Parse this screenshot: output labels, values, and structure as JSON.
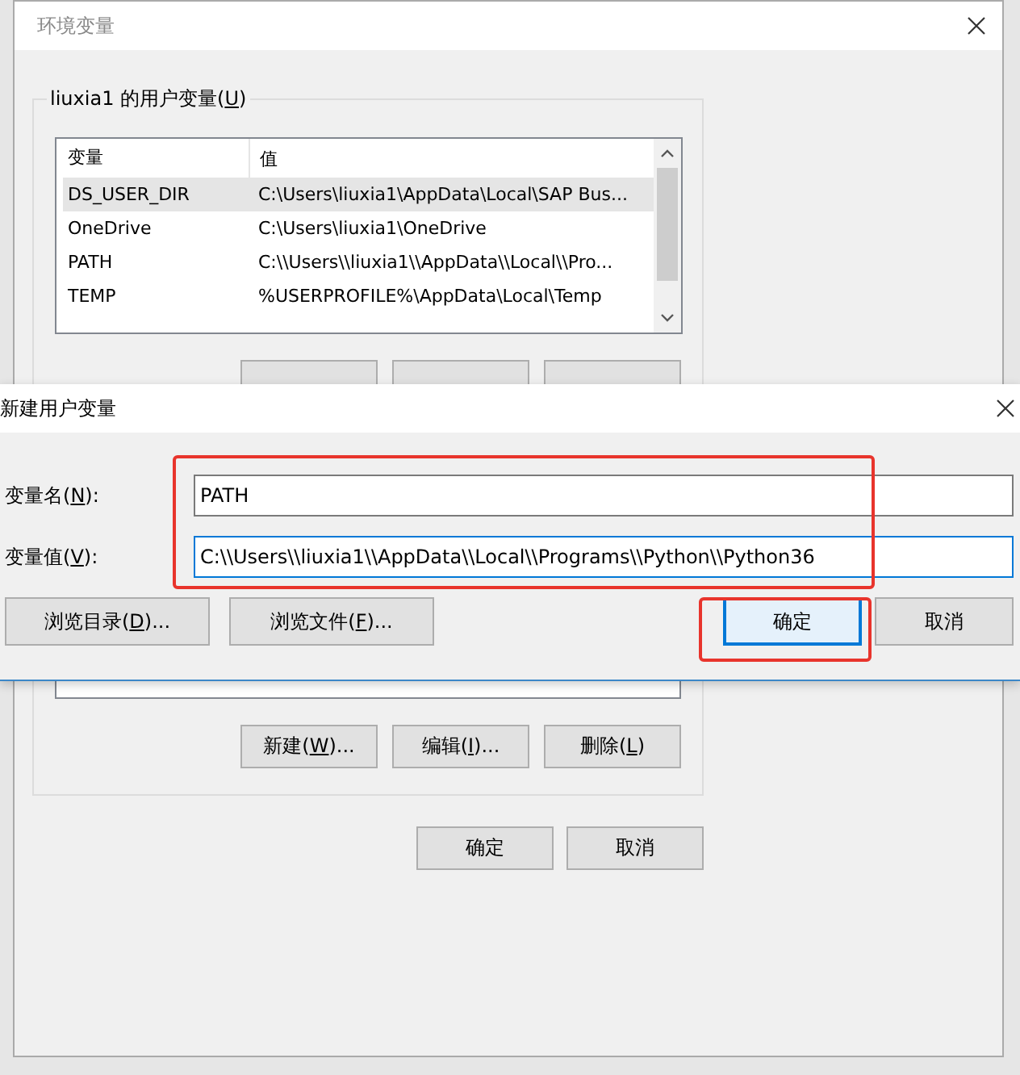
{
  "background_window": {
    "title": "环境变量",
    "user_variables": {
      "legend": {
        "before": "liuxia1 的用户变量(",
        "key": "U",
        "after": ")"
      },
      "columns": [
        "变量",
        "值"
      ],
      "rows": [
        {
          "name": "DS_USER_DIR",
          "value": "C:\\Users\\liuxia1\\AppData\\Local\\SAP Bus...",
          "selected": true
        },
        {
          "name": "OneDrive",
          "value": "C:\\Users\\liuxia1\\OneDrive",
          "selected": false
        },
        {
          "name": "PATH",
          "value": "C:\\\\Users\\\\liuxia1\\\\AppData\\\\Local\\\\Pro...",
          "selected": false
        },
        {
          "name": "TEMP",
          "value": "%USERPROFILE%\\AppData\\Local\\Temp",
          "selected": false
        }
      ]
    },
    "system_buttons": [
      {
        "before": "新建(",
        "key": "W",
        "after": ")..."
      },
      {
        "before": "编辑(",
        "key": "I",
        "after": ")..."
      },
      {
        "before": "删除(",
        "key": "L",
        "after": ")"
      }
    ],
    "buttons": [
      "确定",
      "取消"
    ]
  },
  "dialog": {
    "title": "新建用户变量",
    "fields": [
      {
        "label": {
          "before": "变量名(",
          "key": "N",
          "after": "):"
        },
        "value": "PATH",
        "focused": false
      },
      {
        "label": {
          "before": "变量值(",
          "key": "V",
          "after": "):"
        },
        "value": "C:\\\\Users\\\\liuxia1\\\\AppData\\\\Local\\\\Programs\\\\Python\\\\Python36",
        "focused": true
      }
    ],
    "browse_buttons": [
      {
        "before": "浏览目录(",
        "key": "D",
        "after": ")..."
      },
      {
        "before": "浏览文件(",
        "key": "F",
        "after": ")..."
      }
    ],
    "buttons": [
      {
        "label": "确定",
        "default": true
      },
      {
        "label": "取消",
        "default": false
      }
    ]
  }
}
